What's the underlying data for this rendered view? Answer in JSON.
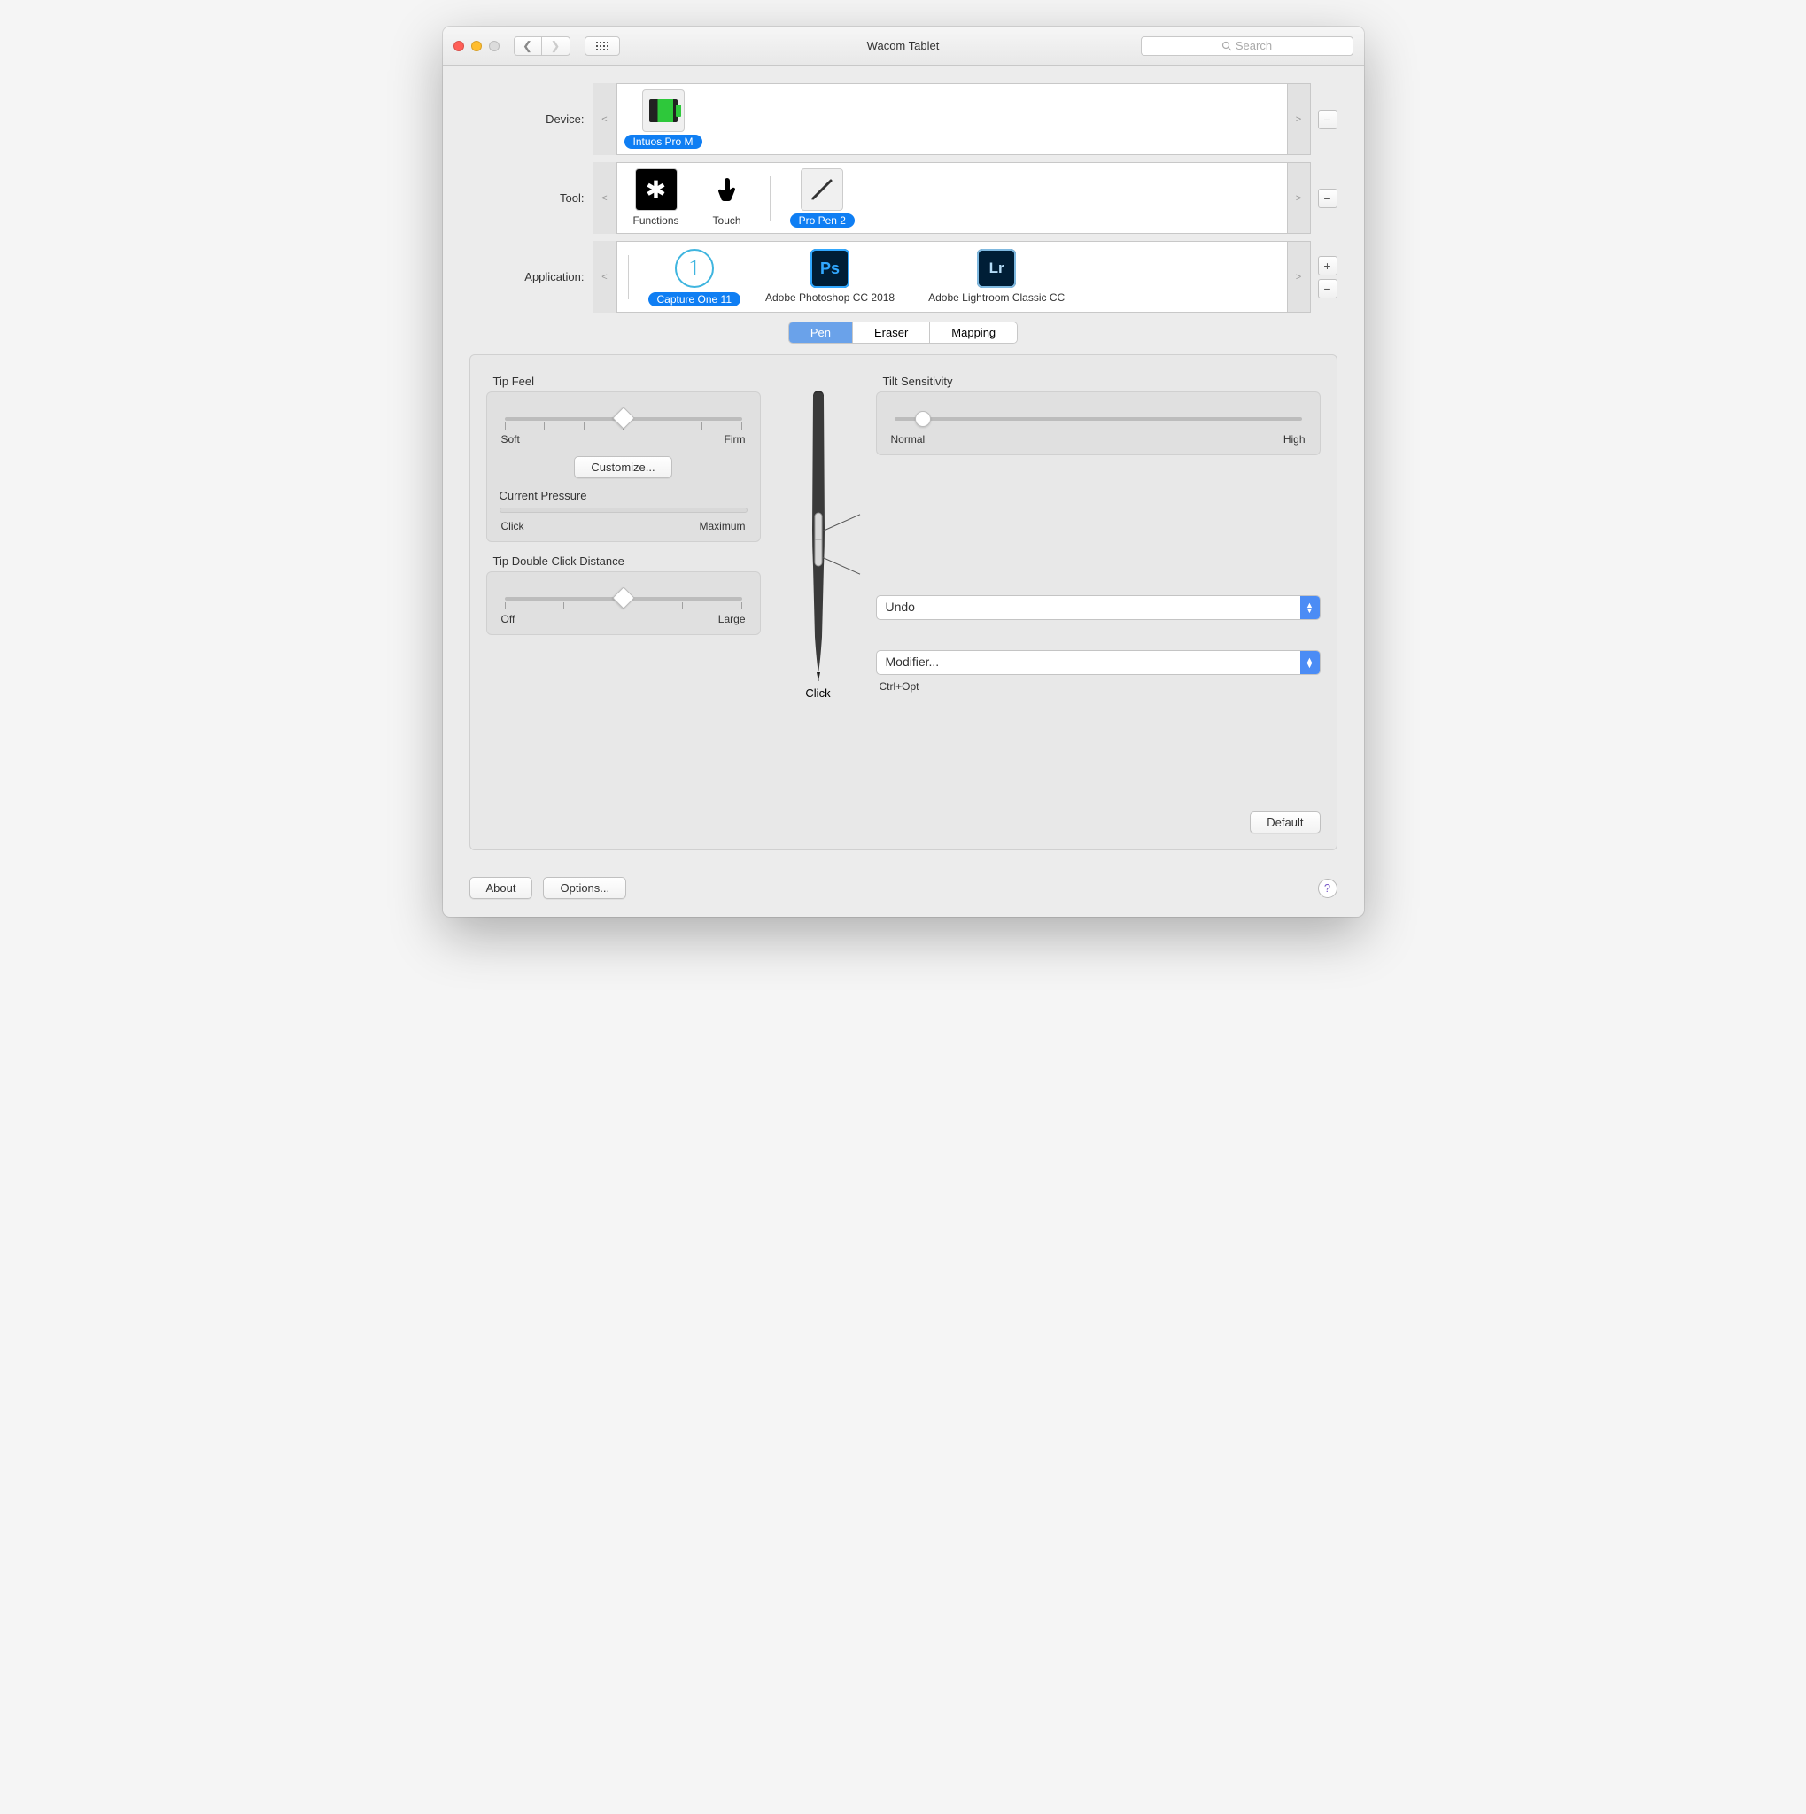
{
  "window": {
    "title": "Wacom Tablet",
    "search_placeholder": "Search"
  },
  "pickers": {
    "device": {
      "label": "Device:",
      "items": [
        {
          "label": "Intuos Pro M",
          "selected": true
        }
      ]
    },
    "tool": {
      "label": "Tool:",
      "items": [
        {
          "label": "Functions",
          "selected": false
        },
        {
          "label": "Touch",
          "selected": false
        },
        {
          "label": "Pro Pen 2",
          "selected": true
        }
      ]
    },
    "application": {
      "label": "Application:",
      "items": [
        {
          "label": "Capture One 11",
          "selected": true
        },
        {
          "label": "Adobe Photoshop CC 2018",
          "selected": false
        },
        {
          "label": "Adobe Lightroom Classic CC",
          "selected": false
        }
      ]
    }
  },
  "tabs": [
    {
      "label": "Pen",
      "active": true
    },
    {
      "label": "Eraser",
      "active": false
    },
    {
      "label": "Mapping",
      "active": false
    }
  ],
  "pen_panel": {
    "tip_feel": {
      "title": "Tip Feel",
      "min_label": "Soft",
      "max_label": "Firm",
      "value_pct": 50,
      "customize_label": "Customize..."
    },
    "current_pressure": {
      "title": "Current Pressure",
      "min_label": "Click",
      "max_label": "Maximum"
    },
    "double_click": {
      "title": "Tip Double Click Distance",
      "min_label": "Off",
      "max_label": "Large",
      "value_pct": 50
    },
    "tilt": {
      "title": "Tilt Sensitivity",
      "min_label": "Normal",
      "max_label": "High",
      "value_pct": 7
    },
    "button_upper": {
      "value": "Undo"
    },
    "button_lower": {
      "value": "Modifier...",
      "sub": "Ctrl+Opt"
    },
    "tip_label": "Click",
    "default_label": "Default"
  },
  "footer": {
    "about": "About",
    "options": "Options..."
  }
}
